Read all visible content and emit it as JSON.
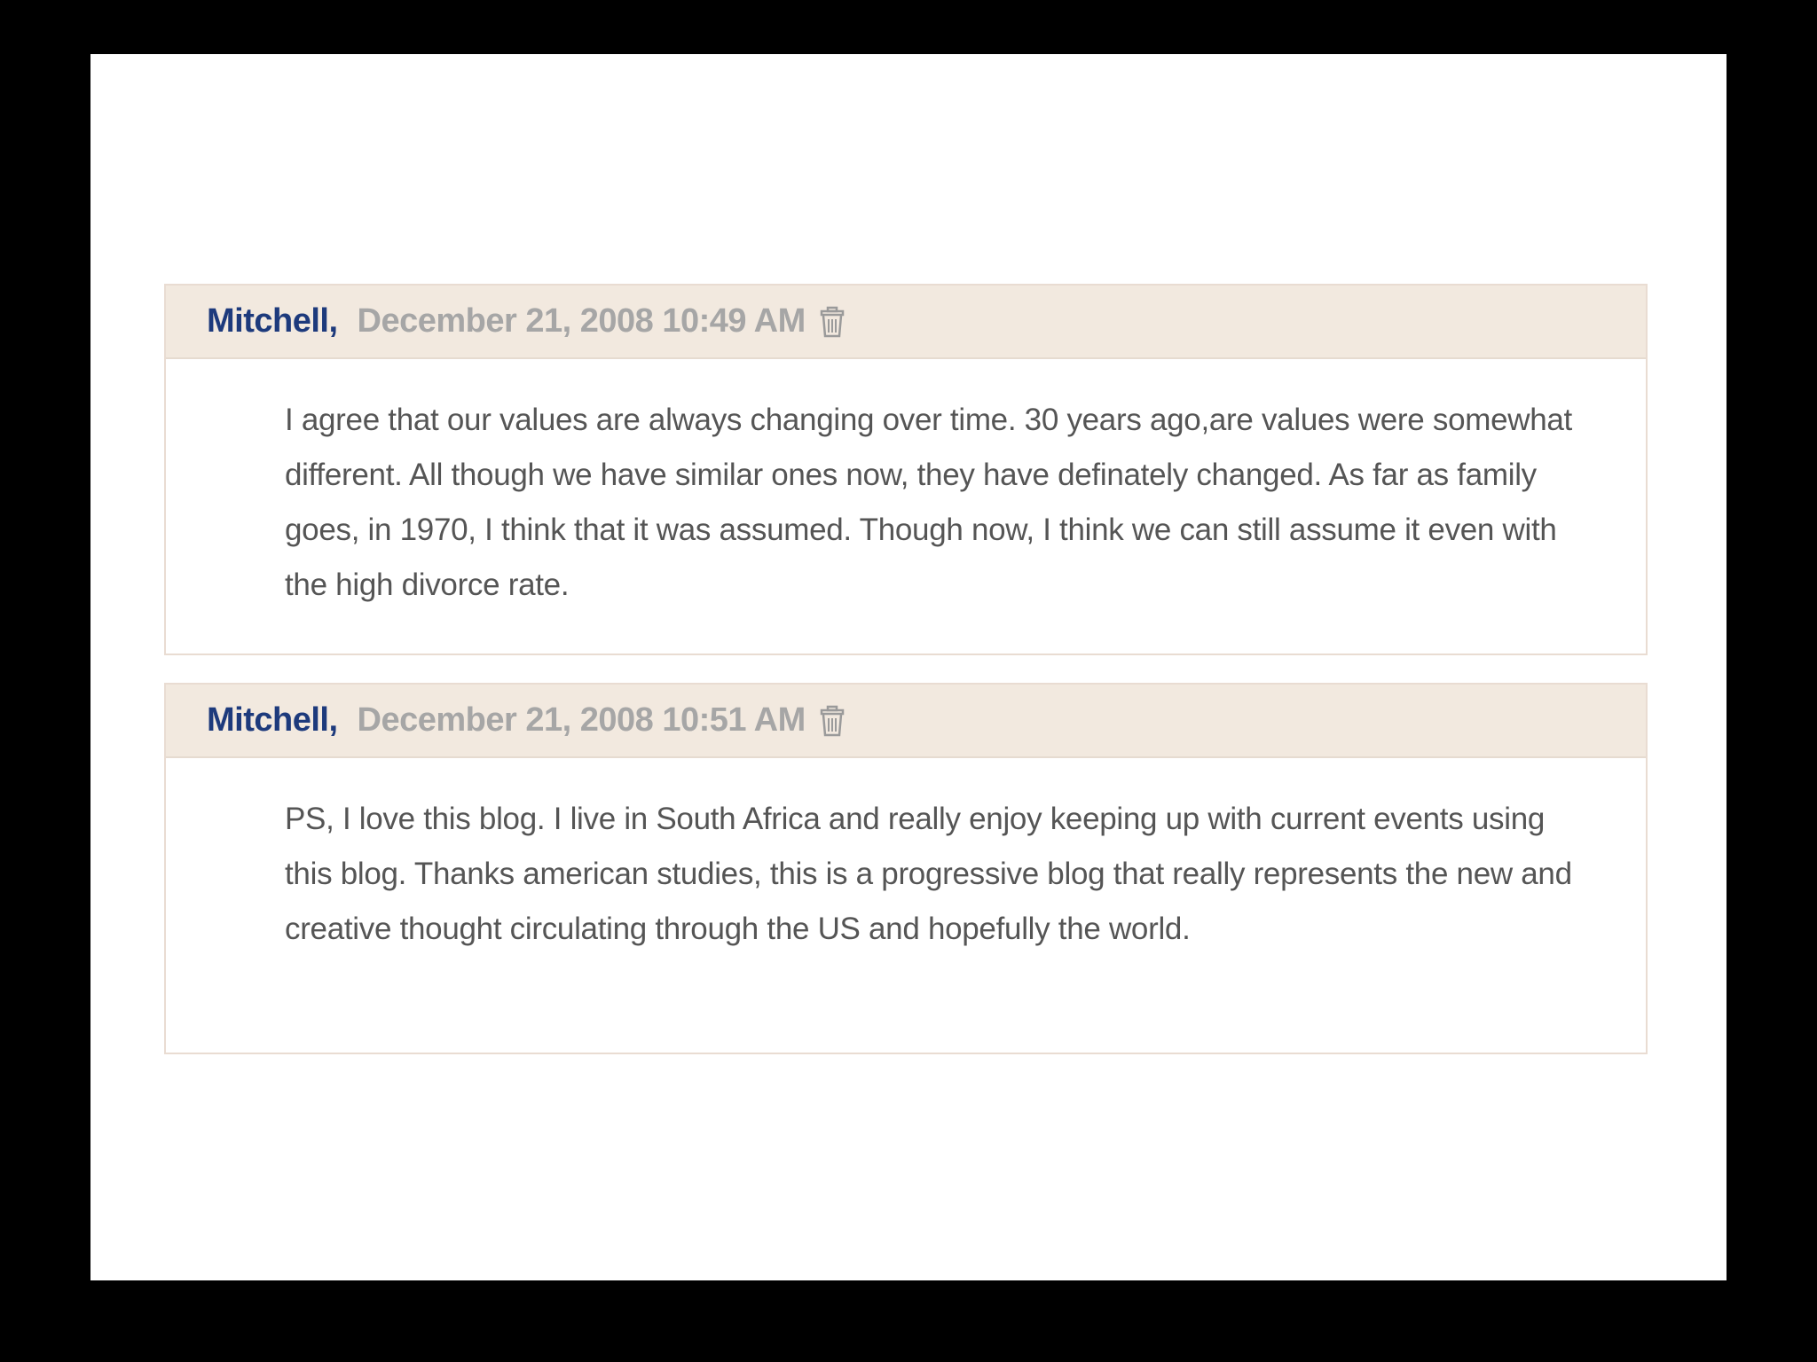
{
  "comments": [
    {
      "author": "Mitchell,",
      "date": "December 21, 2008 10:49 AM",
      "body": "I agree that our values are always changing over time. 30 years ago,are values were somewhat different. All though we have similar ones now, they have definately changed. As far as family goes, in 1970, I think that it was assumed. Though now, I think we can still assume it even with the high divorce rate."
    },
    {
      "author": "Mitchell,",
      "date": "December 21, 2008 10:51 AM",
      "body": "PS, I love this blog. I live in South Africa and really enjoy keeping up with current events using this blog. Thanks american studies, this is a progressive blog that really represents the new and creative thought circulating through the US and hopefully the world."
    }
  ],
  "colors": {
    "author": "#1d3a7c",
    "date": "#a6a6a6",
    "header_bg": "#f2e9df",
    "body_text": "#555555"
  },
  "icons": {
    "delete": "trash-icon"
  }
}
